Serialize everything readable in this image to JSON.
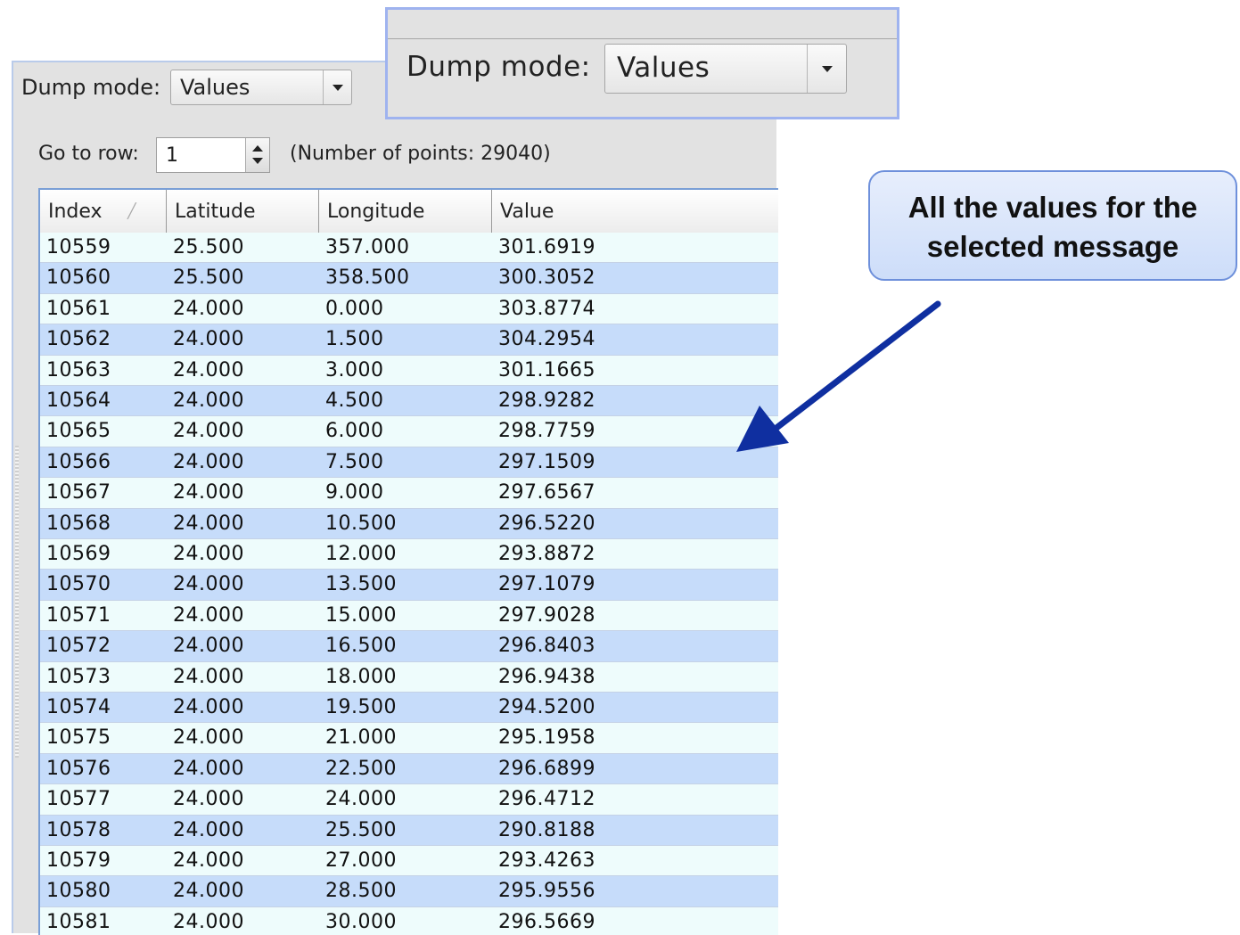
{
  "dump_mode": {
    "label": "Dump mode:",
    "value": "Values"
  },
  "goto": {
    "label": "Go to row:",
    "value": "1",
    "points_text": "(Number of points: 29040)"
  },
  "table": {
    "columns": [
      "Index",
      "Latitude",
      "Longitude",
      "Value"
    ],
    "rows": [
      [
        "10559",
        "25.500",
        "357.000",
        "301.6919"
      ],
      [
        "10560",
        "25.500",
        "358.500",
        "300.3052"
      ],
      [
        "10561",
        "24.000",
        "0.000",
        "303.8774"
      ],
      [
        "10562",
        "24.000",
        "1.500",
        "304.2954"
      ],
      [
        "10563",
        "24.000",
        "3.000",
        "301.1665"
      ],
      [
        "10564",
        "24.000",
        "4.500",
        "298.9282"
      ],
      [
        "10565",
        "24.000",
        "6.000",
        "298.7759"
      ],
      [
        "10566",
        "24.000",
        "7.500",
        "297.1509"
      ],
      [
        "10567",
        "24.000",
        "9.000",
        "297.6567"
      ],
      [
        "10568",
        "24.000",
        "10.500",
        "296.5220"
      ],
      [
        "10569",
        "24.000",
        "12.000",
        "293.8872"
      ],
      [
        "10570",
        "24.000",
        "13.500",
        "297.1079"
      ],
      [
        "10571",
        "24.000",
        "15.000",
        "297.9028"
      ],
      [
        "10572",
        "24.000",
        "16.500",
        "296.8403"
      ],
      [
        "10573",
        "24.000",
        "18.000",
        "296.9438"
      ],
      [
        "10574",
        "24.000",
        "19.500",
        "294.5200"
      ],
      [
        "10575",
        "24.000",
        "21.000",
        "295.1958"
      ],
      [
        "10576",
        "24.000",
        "22.500",
        "296.6899"
      ],
      [
        "10577",
        "24.000",
        "24.000",
        "296.4712"
      ],
      [
        "10578",
        "24.000",
        "25.500",
        "290.8188"
      ],
      [
        "10579",
        "24.000",
        "27.000",
        "293.4263"
      ],
      [
        "10580",
        "24.000",
        "28.500",
        "295.9556"
      ],
      [
        "10581",
        "24.000",
        "30.000",
        "296.5669"
      ]
    ]
  },
  "inset": {
    "label": "Dump mode:",
    "value": "Values"
  },
  "callout": {
    "line1": "All the values for the",
    "line2": "selected message"
  },
  "colors": {
    "row_odd": "#eefcfc",
    "row_even": "#c6dcfa",
    "arrow": "#0f2fa0",
    "callout_border": "#6e90db"
  },
  "icons": {
    "sort": "sort-ascending-icon",
    "dropdown": "chevron-down-icon"
  }
}
